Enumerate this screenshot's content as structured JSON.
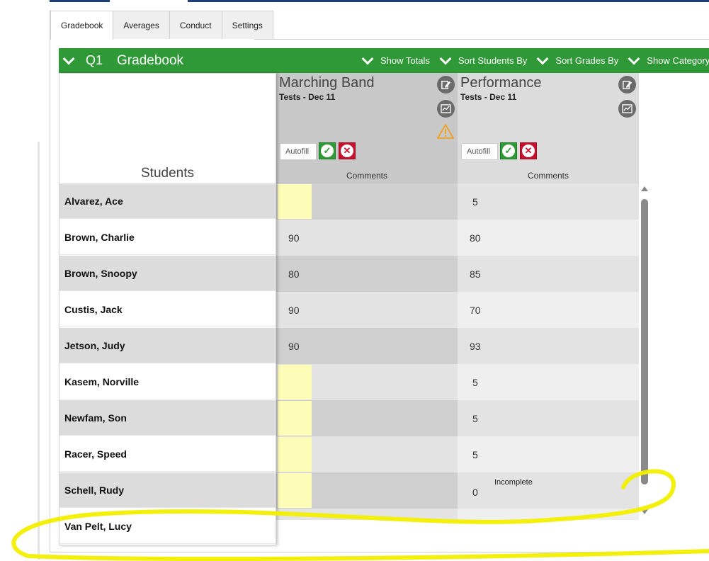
{
  "tabs": [
    "Gradebook",
    "Averages",
    "Conduct",
    "Settings"
  ],
  "header": {
    "quarter": "Q1",
    "title": "Gradebook",
    "actions": [
      "Show Totals",
      "Sort Students By",
      "Sort Grades By",
      "Show Category"
    ]
  },
  "students_header": "Students",
  "students": [
    "Alvarez, Ace",
    "Brown, Charlie",
    "Brown, Snoopy",
    "Custis, Jack",
    "Jetson, Judy",
    "Kasem, Norville",
    "Newfam, Son",
    "Racer, Speed",
    "Schell, Rudy",
    "Van Pelt, Lucy"
  ],
  "assignments": [
    {
      "title": "Marching Band",
      "subtitle": "Tests - Dec 11",
      "autofill": "Autofill",
      "comments": "Comments",
      "grades": [
        "",
        "90",
        "80",
        "90",
        "90",
        "",
        "",
        "",
        ""
      ]
    },
    {
      "title": "Performance",
      "subtitle": "Tests - Dec 11",
      "autofill": "Autofill",
      "comments": "Comments",
      "grades": [
        "5",
        "80",
        "85",
        "70",
        "93",
        "5",
        "5",
        "5",
        "0"
      ],
      "notes": [
        "",
        "",
        "",
        "",
        "",
        "",
        "",
        "",
        "Incomplete"
      ]
    }
  ],
  "colors": {
    "header_green": "#2e9936",
    "empty_grade_yellow": "#fdfdb8",
    "highlight_annotation": "#f2ef00",
    "warning_orange": "#f0a020"
  }
}
